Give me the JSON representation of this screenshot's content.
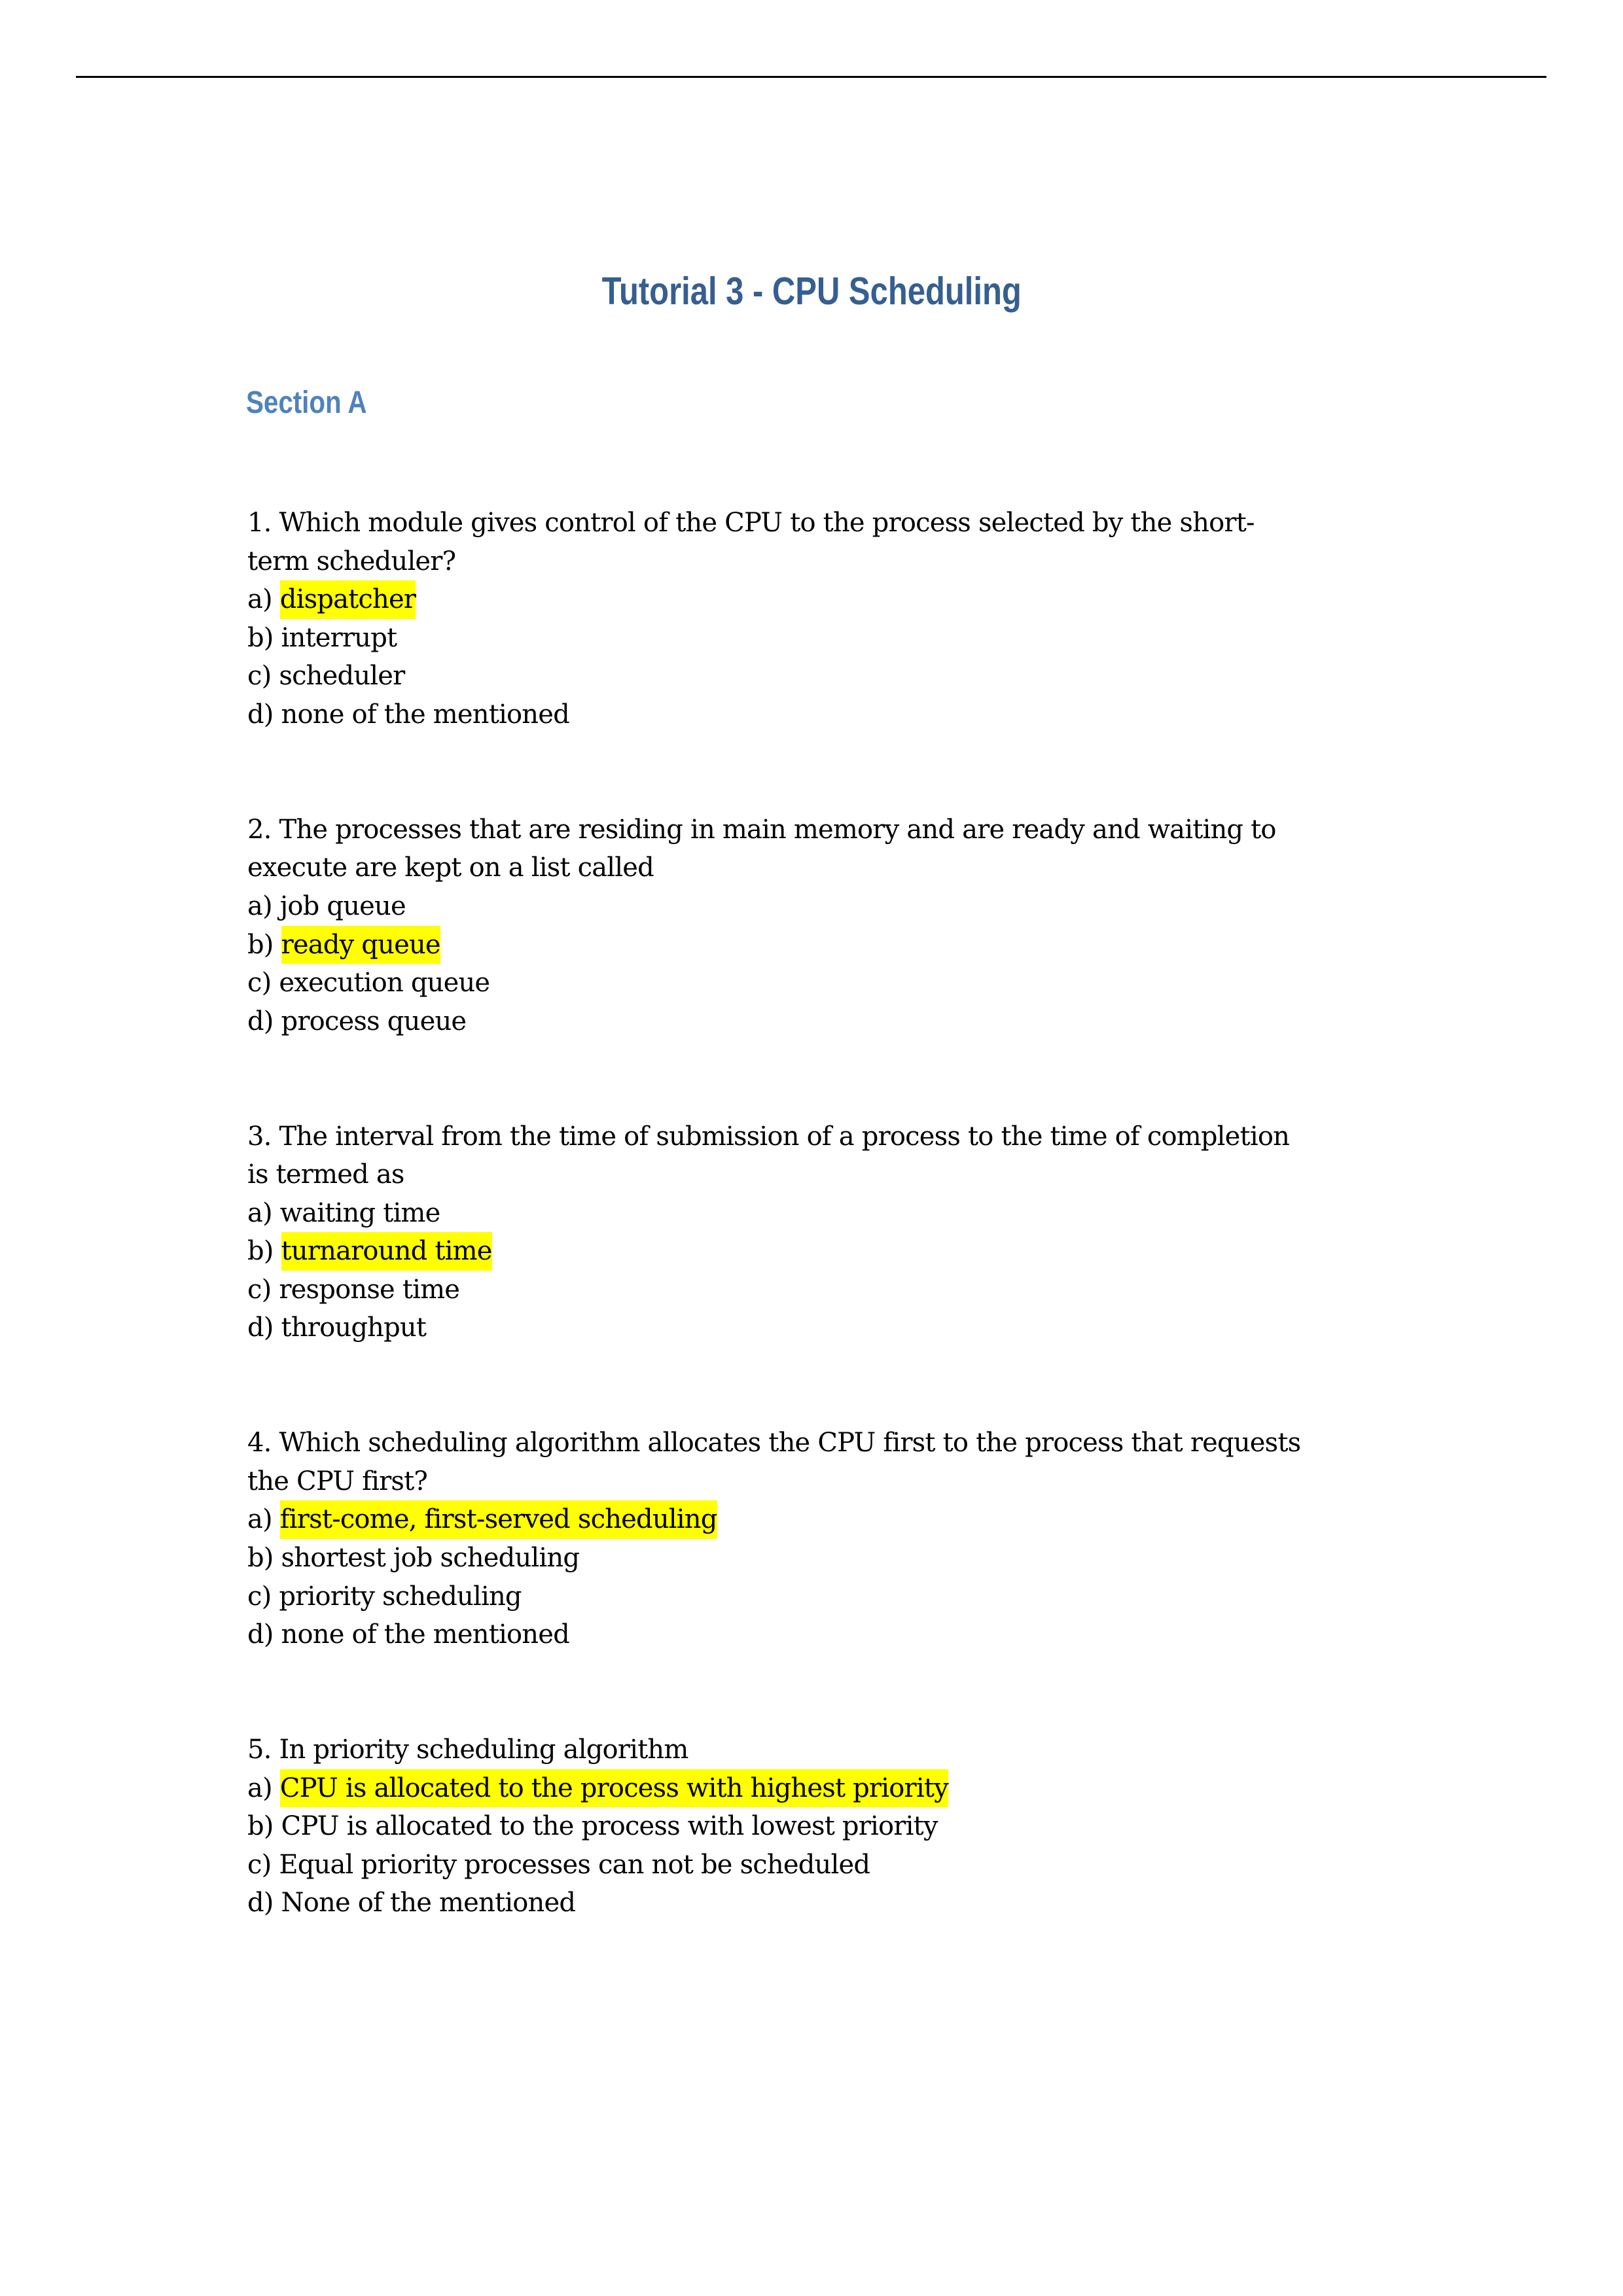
{
  "document": {
    "title": "Tutorial 3 - CPU Scheduling",
    "section": "Section A",
    "highlight_color": "#FFFF00",
    "title_color": "#365F91",
    "section_color": "#4F81BD"
  },
  "questions": [
    {
      "number": "1.",
      "lines": [
        "1. Which module gives control of the CPU to the process selected by the short-",
        "term scheduler?"
      ],
      "options": [
        {
          "letter": "a)",
          "text": "dispatcher",
          "highlighted": true
        },
        {
          "letter": "b)",
          "text": "interrupt",
          "highlighted": false
        },
        {
          "letter": "c)",
          "text": "scheduler",
          "highlighted": false
        },
        {
          "letter": "d)",
          "text": "none of the mentioned",
          "highlighted": false
        }
      ]
    },
    {
      "number": "2.",
      "lines": [
        "2. The processes that are residing in main memory and are ready and waiting to",
        "execute are kept on a list called"
      ],
      "options": [
        {
          "letter": "a)",
          "text": "job queue",
          "highlighted": false
        },
        {
          "letter": "b)",
          "text": "ready queue",
          "highlighted": true
        },
        {
          "letter": "c)",
          "text": "execution queue",
          "highlighted": false
        },
        {
          "letter": "d)",
          "text": "process queue",
          "highlighted": false
        }
      ]
    },
    {
      "number": "3.",
      "lines": [
        "3. The interval from the time of submission of a process to the time of completion",
        "is termed as"
      ],
      "options": [
        {
          "letter": "a)",
          "text": "waiting time",
          "highlighted": false
        },
        {
          "letter": "b)",
          "text": "turnaround time",
          "highlighted": true
        },
        {
          "letter": "c)",
          "text": "response time",
          "highlighted": false
        },
        {
          "letter": "d)",
          "text": "throughput",
          "highlighted": false
        }
      ]
    },
    {
      "number": "4.",
      "lines": [
        "4. Which scheduling algorithm allocates the CPU first to the process that requests",
        "the CPU first?"
      ],
      "options": [
        {
          "letter": "a)",
          "text": "first-come, first-served scheduling",
          "highlighted": true
        },
        {
          "letter": "b)",
          "text": "shortest job scheduling",
          "highlighted": false
        },
        {
          "letter": "c)",
          "text": "priority scheduling",
          "highlighted": false
        },
        {
          "letter": "d)",
          "text": "none of the mentioned",
          "highlighted": false
        }
      ]
    },
    {
      "number": "5.",
      "lines": [
        "5. In priority scheduling algorithm"
      ],
      "options": [
        {
          "letter": "a)",
          "text": "CPU is allocated to the process with highest priority",
          "highlighted": true
        },
        {
          "letter": "b)",
          "text": "CPU is allocated to the process with lowest priority",
          "highlighted": false
        },
        {
          "letter": "c)",
          "text": "Equal priority processes can not be scheduled",
          "highlighted": false
        },
        {
          "letter": "d)",
          "text": "None of the mentioned",
          "highlighted": false
        }
      ]
    }
  ]
}
